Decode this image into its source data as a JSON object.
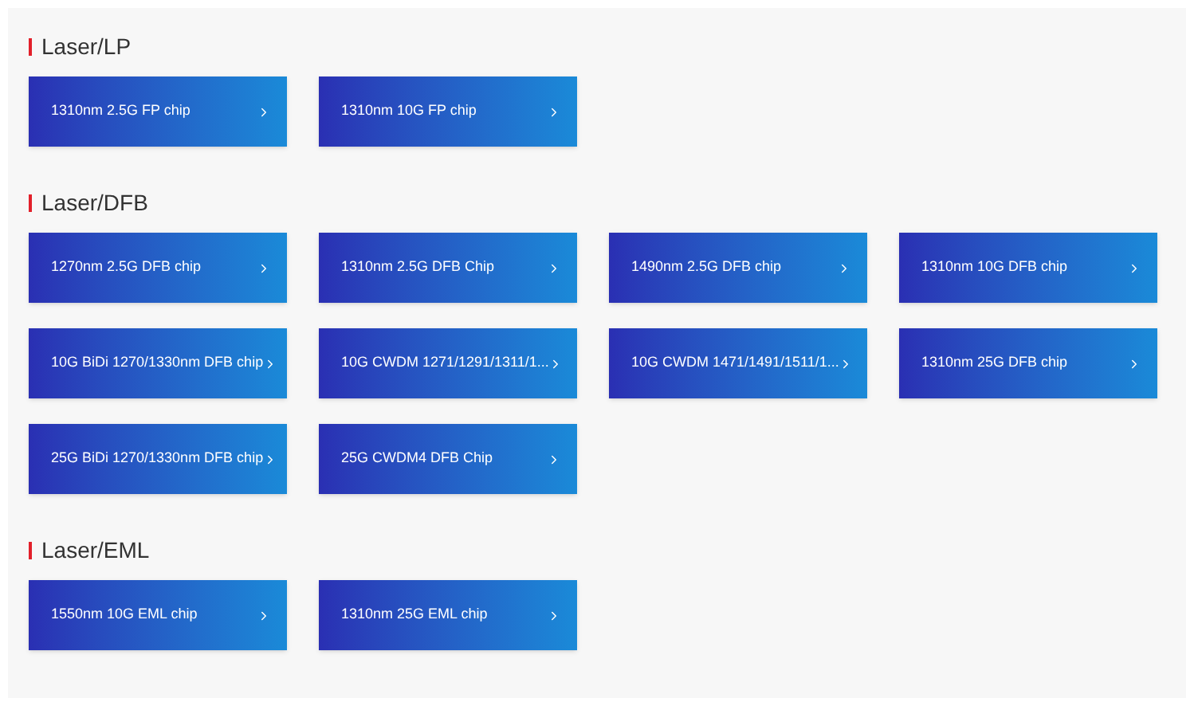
{
  "sections": [
    {
      "title": "Laser/LP",
      "items": [
        "1310nm 2.5G FP chip",
        "1310nm 10G FP chip"
      ]
    },
    {
      "title": "Laser/DFB",
      "items": [
        "1270nm 2.5G DFB chip",
        "1310nm 2.5G DFB Chip",
        "1490nm 2.5G DFB chip",
        "1310nm 10G DFB chip",
        "10G BiDi 1270/1330nm DFB chip",
        "10G CWDM 1271/1291/1311/1...",
        "10G CWDM 1471/1491/1511/1...",
        "1310nm 25G DFB chip",
        "25G BiDi 1270/1330nm DFB chip",
        "25G CWDM4 DFB Chip"
      ]
    },
    {
      "title": "Laser/EML",
      "items": [
        "1550nm 10G EML chip",
        "1310nm 25G EML chip"
      ]
    }
  ]
}
